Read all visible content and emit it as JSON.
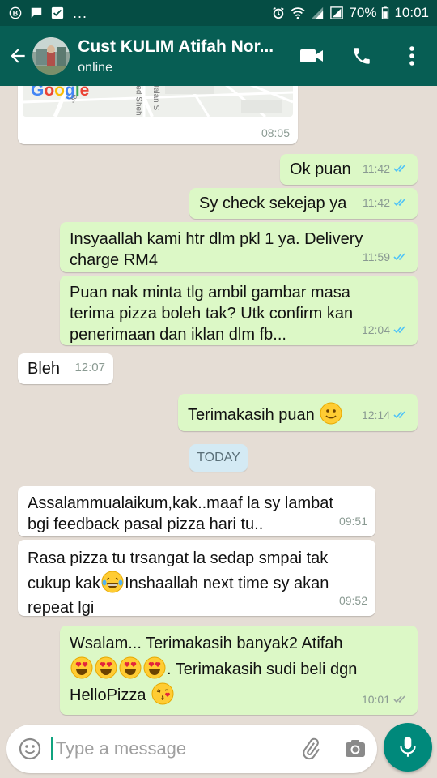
{
  "status_bar": {
    "battery": "70%",
    "time": "10:01",
    "notif_more": "..."
  },
  "header": {
    "title": "Cust KULIM Atifah Nor...",
    "subtitle": "online"
  },
  "map_message": {
    "logo": "Google",
    "road_a": "Ja",
    "road_b": "yed Sheh",
    "road_c": "Jalan S",
    "time": "08:05"
  },
  "messages": [
    {
      "dir": "out",
      "text": "Ok puan",
      "time": "11:42",
      "ticks": "blue"
    },
    {
      "dir": "out",
      "text": "Sy check sekejap ya",
      "time": "11:42",
      "ticks": "blue"
    },
    {
      "dir": "out",
      "lines": [
        "Insyaallah kami htr dlm pkl 1 ya. Delivery",
        "charge RM4"
      ],
      "time": "11:59",
      "ticks": "blue"
    },
    {
      "dir": "out",
      "lines": [
        "Puan nak minta tlg ambil gambar masa",
        "terima pizza boleh tak? Utk confirm kan",
        "penerimaan dan iklan dlm fb..."
      ],
      "time": "12:04",
      "ticks": "blue"
    },
    {
      "dir": "in",
      "text": "Bleh",
      "time": "12:07"
    },
    {
      "dir": "out",
      "text": "Terimakasih puan",
      "emoji": "slightly-smiling-face",
      "time": "12:14",
      "ticks": "blue"
    },
    {
      "dir": "in",
      "lines": [
        "Assalammualaikum,kak..maaf la sy lambat",
        "bgi feedback pasal pizza hari tu.."
      ],
      "time": "09:51"
    },
    {
      "dir": "in",
      "lines": [
        "Rasa pizza tu trsangat la sedap smpai tak",
        "cukup kak",
        "Inshaallah next time sy akan",
        "repeat lgi"
      ],
      "emoji": "face-with-tears-of-joy",
      "time": "09:52"
    },
    {
      "dir": "out",
      "lines": [
        "Wsalam... Terimakasih banyak2 Atifah",
        ". Terimakasih  sudi beli dgn",
        "HelloPizza"
      ],
      "emojis": [
        "heart-eyes",
        "heart-eyes",
        "heart-eyes",
        "heart-eyes",
        "face-blowing-kiss"
      ],
      "time": "10:01",
      "ticks": "grey"
    }
  ],
  "day_chip": "TODAY",
  "input": {
    "placeholder": "Type a message"
  },
  "icons": {
    "back": "arrow-back-icon",
    "video": "video-call-icon",
    "call": "phone-icon",
    "menu": "more-vert-icon",
    "emoji": "smiley-icon",
    "attach": "paperclip-icon",
    "camera": "camera-icon",
    "mic": "microphone-icon"
  },
  "colors": {
    "appbar": "#075e54",
    "statusbar": "#054d44",
    "bubble_out": "#dcf8c6",
    "bubble_in": "#ffffff",
    "chat_bg": "#e5ddd5",
    "tick_blue": "#4fc3f7",
    "mic_bg": "#00897b"
  }
}
